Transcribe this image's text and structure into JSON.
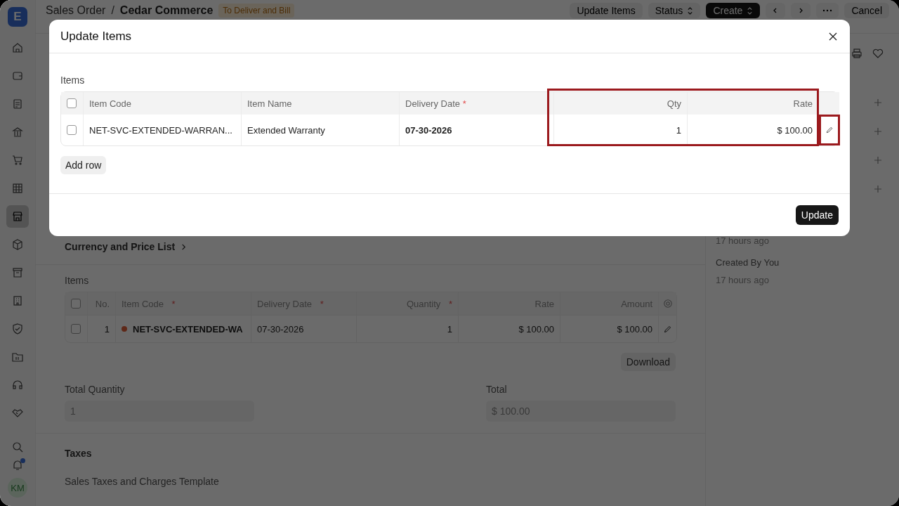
{
  "app": {
    "logo": "E",
    "avatar": "KM",
    "notification_dot": true
  },
  "sidebar": {
    "items": [
      {
        "kind": "home",
        "selected": false
      },
      {
        "kind": "wallet",
        "selected": false
      },
      {
        "kind": "document",
        "selected": false
      },
      {
        "kind": "bank",
        "selected": false
      },
      {
        "kind": "cart",
        "selected": false
      },
      {
        "kind": "table",
        "selected": false
      },
      {
        "kind": "store",
        "selected": true
      },
      {
        "kind": "box",
        "selected": false
      },
      {
        "kind": "archive",
        "selected": false
      },
      {
        "kind": "building",
        "selected": false
      },
      {
        "kind": "shield",
        "selected": false
      },
      {
        "kind": "folder",
        "selected": false
      },
      {
        "kind": "headset",
        "selected": false
      },
      {
        "kind": "handshake",
        "selected": false
      }
    ]
  },
  "header": {
    "breadcrumb": "Sales Order",
    "separator": "/",
    "title": "Cedar Commerce",
    "status": "To Deliver and Bill",
    "buttons": [
      {
        "label": "Update Items",
        "kind": "plain"
      },
      {
        "label": "Status",
        "kind": "select"
      },
      {
        "label": "Create",
        "kind": "primary-select"
      }
    ],
    "cancel": "Cancel"
  },
  "form": {
    "section": "Currency and Price List",
    "items_label": "Items",
    "items_table": {
      "all_checked": false,
      "columns": [
        {
          "label": "No."
        },
        {
          "label": "Item Code",
          "mark": "*"
        },
        {
          "label": "Delivery Date",
          "mark": "*"
        },
        {
          "label": "Quantity",
          "mark": "*"
        },
        {
          "label": "Rate"
        },
        {
          "label": "Amount"
        }
      ],
      "rows": [
        {
          "no": "1",
          "item_code": "NET-SVC-EXTENDED-WA",
          "delivery_date": "07-30-2026",
          "quantity": "1",
          "rate": "$ 100.00",
          "amount": "$ 100.00",
          "checked": false
        }
      ]
    },
    "download": "Download",
    "total_quantity": {
      "label": "Total Quantity",
      "value": "1"
    },
    "total": {
      "label": "Total",
      "value": "$ 100.00"
    },
    "taxes": "Taxes",
    "taxes_template": "Sales Taxes and Charges Template"
  },
  "activity": [
    {
      "text": "17 hours ago",
      "kind": "time"
    },
    {
      "text": "Created By You",
      "kind": "event"
    },
    {
      "text": "17 hours ago",
      "kind": "time"
    }
  ],
  "dialog": {
    "title": "Update Items",
    "items_label": "Items",
    "columns": [
      {
        "label": "Item Code",
        "highlighted": false
      },
      {
        "label": "Item Name",
        "highlighted": false
      },
      {
        "label": "Delivery Date",
        "mark": "*",
        "highlighted": false
      },
      {
        "label": "Qty",
        "highlighted": true
      },
      {
        "label": "Rate",
        "highlighted": true
      }
    ],
    "rows": [
      {
        "item_code": "NET-SVC-EXTENDED-WARRAN...",
        "item_name": "Extended Warranty",
        "delivery_date": "07-30-2026",
        "qty": "1",
        "rate": "$ 100.00",
        "checked": false
      }
    ],
    "edit_highlighted": true,
    "all_checked": false,
    "add_row": "Add row",
    "submit": "Update"
  }
}
